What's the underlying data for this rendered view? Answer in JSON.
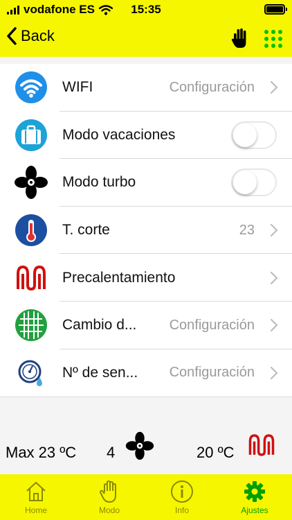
{
  "status_bar": {
    "carrier": "vodafone ES",
    "time": "15:35"
  },
  "nav": {
    "back_label": "Back"
  },
  "settings": [
    {
      "icon": "wifi-icon",
      "label": "WIFI",
      "value": "Configuración",
      "type": "link"
    },
    {
      "icon": "suitcase-icon",
      "label": "Modo vacaciones",
      "type": "toggle",
      "on": false
    },
    {
      "icon": "fan-icon",
      "label": "Modo turbo",
      "type": "toggle",
      "on": false
    },
    {
      "icon": "thermometer-icon",
      "label": "T. corte",
      "value": "23",
      "type": "link"
    },
    {
      "icon": "heating-coil-icon",
      "label": "Precalentamiento",
      "value": "",
      "type": "link"
    },
    {
      "icon": "grille-icon",
      "label": "Cambio d...",
      "value": "Configuración",
      "type": "link"
    },
    {
      "icon": "sensor-icon",
      "label": "Nº de sen...",
      "value": "Configuración",
      "type": "link"
    }
  ],
  "summary": {
    "max_temp": "Max 23 ºC",
    "fan_speed": "4",
    "current_temp": "20 ºC"
  },
  "tabs": [
    {
      "label": "Home",
      "icon": "home-icon"
    },
    {
      "label": "Modo",
      "icon": "hand-icon"
    },
    {
      "label": "Info",
      "icon": "info-icon"
    },
    {
      "label": "Ajustes",
      "icon": "gear-icon",
      "active": true
    }
  ],
  "colors": {
    "bar": "#f6f600",
    "accent_green": "#00c000",
    "value_gray": "#9a9a9a"
  }
}
